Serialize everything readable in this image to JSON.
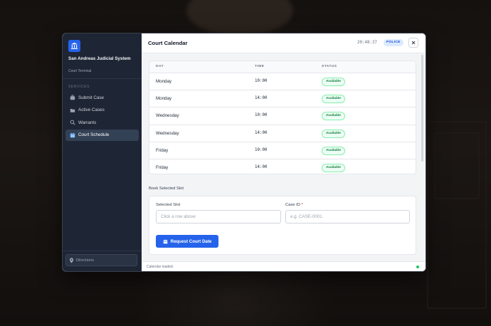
{
  "app": {
    "org_name": "San Andreas Judicial System",
    "org_sub": "Court Terminal"
  },
  "sidebar": {
    "section_label": "SERVICES",
    "items": [
      {
        "label": "Submit Case",
        "icon": "briefcase-icon"
      },
      {
        "label": "Active Cases",
        "icon": "folder-icon"
      },
      {
        "label": "Warrants",
        "icon": "search-icon"
      },
      {
        "label": "Court Schedule",
        "icon": "calendar-icon",
        "active": true
      }
    ],
    "directions_label": "Directions"
  },
  "header": {
    "title": "Court Calendar",
    "clock": "20:48:37",
    "role": "POLICE"
  },
  "schedule": {
    "columns": [
      "DAY",
      "TIME",
      "STATUS"
    ],
    "rows": [
      {
        "day": "Monday",
        "time": "10:00",
        "status": "Available"
      },
      {
        "day": "Monday",
        "time": "14:00",
        "status": "Available"
      },
      {
        "day": "Wednesday",
        "time": "10:00",
        "status": "Available"
      },
      {
        "day": "Wednesday",
        "time": "14:00",
        "status": "Available"
      },
      {
        "day": "Friday",
        "time": "10:00",
        "status": "Available"
      },
      {
        "day": "Friday",
        "time": "14:00",
        "status": "Available"
      }
    ]
  },
  "booking": {
    "section_title": "Book Selected Slot",
    "slot_label": "Selected Slot",
    "slot_placeholder": "Click a row above",
    "case_label": "Case ID",
    "case_required": "*",
    "case_placeholder": "e.g. CASE-0001",
    "submit_label": "Request Court Date"
  },
  "status_bar": {
    "text": "Calendar loaded."
  },
  "colors": {
    "accent": "#2563eb",
    "sidebar_bg": "#1e2535",
    "available": "#15803d"
  }
}
